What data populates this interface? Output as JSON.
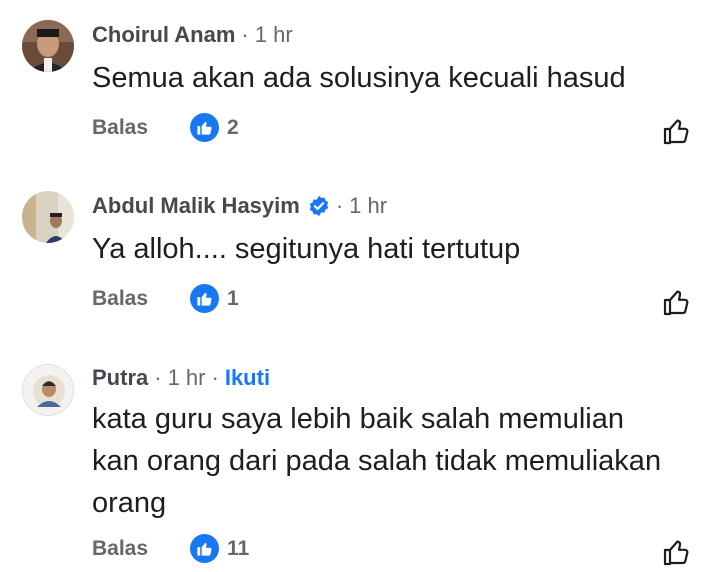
{
  "comments": [
    {
      "author": "Choirul Anam",
      "time": "1 hr",
      "text": "Semua akan ada solusinya kecuali hasud",
      "reply_label": "Balas",
      "like_count": "2"
    },
    {
      "author": "Abdul Malik Hasyim",
      "time": "1 hr",
      "text": "Ya alloh.... segitunya hati tertutup",
      "reply_label": "Balas",
      "like_count": "1"
    },
    {
      "author": "Putra",
      "time": "1 hr",
      "follow_label": "Ikuti",
      "text_lines": [
        "kata guru saya lebih baik salah memulian",
        "kan orang dari pada salah tidak memuliakan",
        "orang"
      ],
      "reply_label": "Balas",
      "like_count": "11"
    }
  ],
  "icons": {
    "verified": "verified-badge-icon",
    "like_reaction": "thumbs-up-reaction-icon",
    "like_button": "thumbs-up-outline-icon"
  },
  "colors": {
    "accent": "#1877f2",
    "secondary_text": "#65676b",
    "author_text": "#444950"
  }
}
